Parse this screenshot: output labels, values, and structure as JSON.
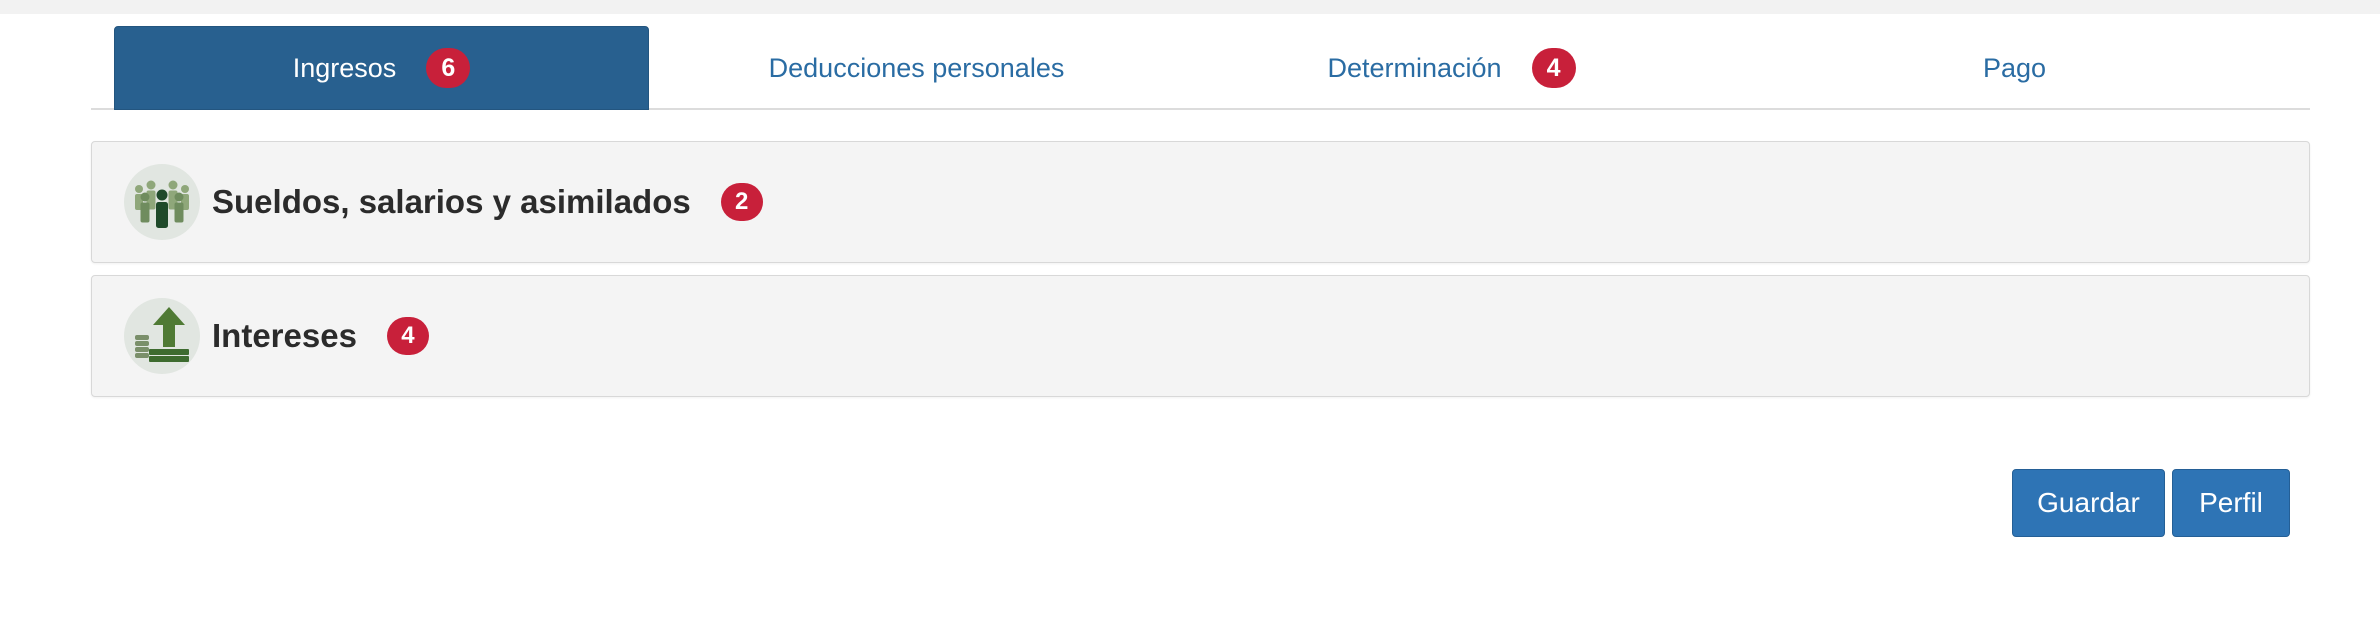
{
  "tabs": [
    {
      "label": "Ingresos",
      "badge": "6",
      "active": true
    },
    {
      "label": "Deducciones personales",
      "badge": null,
      "active": false
    },
    {
      "label": "Determinación",
      "badge": "4",
      "active": false
    },
    {
      "label": "Pago",
      "badge": null,
      "active": false
    }
  ],
  "panels": [
    {
      "title": "Sueldos, salarios y asimilados",
      "badge": "2",
      "icon": "people-group-icon"
    },
    {
      "title": "Intereses",
      "badge": "4",
      "icon": "money-growth-icon"
    }
  ],
  "actions": {
    "save_label": "Guardar",
    "profile_label": "Perfil"
  },
  "colors": {
    "tab_active_bg": "#28608f",
    "tab_text": "#2a6ca3",
    "badge_bg": "#c8203a",
    "button_bg": "#2e74b5",
    "panel_bg": "#f4f4f4"
  }
}
